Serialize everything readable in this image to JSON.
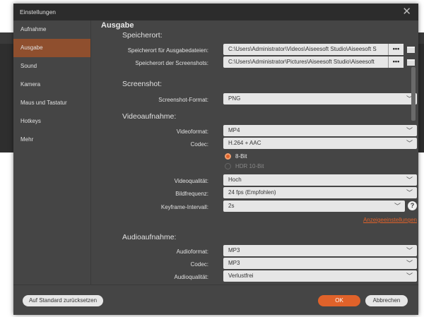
{
  "window": {
    "title": "Einstellungen"
  },
  "sidebar": {
    "items": [
      {
        "label": "Aufnahme"
      },
      {
        "label": "Ausgabe",
        "active": true
      },
      {
        "label": "Sound"
      },
      {
        "label": "Kamera"
      },
      {
        "label": "Maus und Tastatur"
      },
      {
        "label": "Hotkeys"
      },
      {
        "label": "Mehr"
      }
    ]
  },
  "main": {
    "section_title": "Ausgabe",
    "speicherort": {
      "heading": "Speicherort:",
      "output_label": "Speicherort für Ausgabedateien:",
      "output_value": "C:\\Users\\Administrator\\Videos\\Aiseesoft Studio\\Aiseesoft S",
      "screenshot_label": "Speicherort der Screenshots:",
      "screenshot_value": "C:\\Users\\Administrator\\Pictures\\Aiseesoft Studio\\Aiseesoft",
      "browse_label": "•••"
    },
    "screenshot": {
      "heading": "Screenshot:",
      "format_label": "Screenshot-Format:",
      "format_value": "PNG"
    },
    "video": {
      "heading": "Videoaufnahme:",
      "format_label": "Videoformat:",
      "format_value": "MP4",
      "codec_label": "Codec:",
      "codec_value": "H.264 + AAC",
      "bit8_label": "8-Bit",
      "hdr_label": "HDR 10-Bit",
      "selected_bit": "8-Bit",
      "quality_label": "Videoqualität:",
      "quality_value": "Hoch",
      "fps_label": "Bildfrequenz:",
      "fps_value": "24 fps (Empfohlen)",
      "keyframe_label": "Keyframe-Intervall:",
      "keyframe_value": "2s",
      "help": "?",
      "display_link": "Anzeigeeinstellungen"
    },
    "audio": {
      "heading": "Audioaufnahme:",
      "format_label": "Audioformat:",
      "format_value": "MP3",
      "codec_label": "Codec:",
      "codec_value": "MP3",
      "quality_label": "Audioqualität:",
      "quality_value": "Verlustfrei"
    }
  },
  "footer": {
    "reset_label": "Auf Standard zurücksetzen",
    "ok_label": "OK",
    "cancel_label": "Abbrechen"
  },
  "colors": {
    "accent": "#e0622a",
    "sidebar_active": "#8f4f2e",
    "background": "#454545",
    "titlebar": "#2c2c2c"
  }
}
